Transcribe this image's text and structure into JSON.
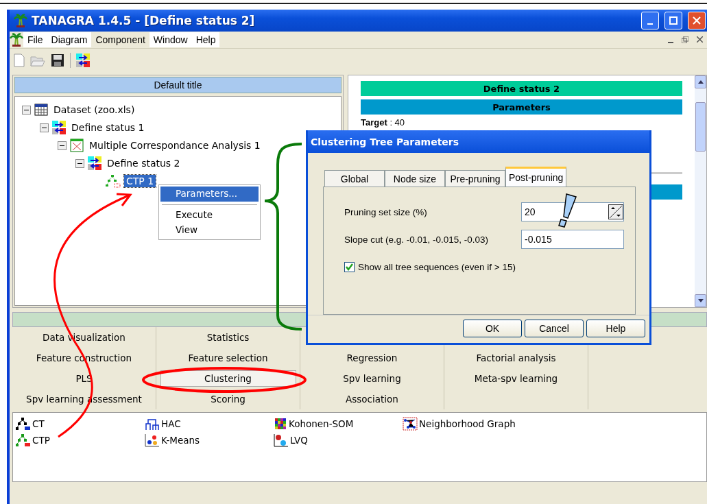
{
  "window": {
    "title": "TANAGRA 1.4.5 - [Define status 2]"
  },
  "menu": [
    {
      "label": "File",
      "selected": false
    },
    {
      "label": "Diagram",
      "selected": false
    },
    {
      "label": "Component",
      "selected": true
    },
    {
      "label": "Window",
      "selected": false
    },
    {
      "label": "Help",
      "selected": false
    }
  ],
  "diagram": {
    "title": "Default title",
    "tree": [
      {
        "label": "Dataset (zoo.xls)",
        "kind": "dataset",
        "selected": false,
        "expanded": true,
        "children": [
          {
            "label": "Define status 1",
            "kind": "status",
            "selected": false,
            "expanded": true,
            "children": [
              {
                "label": "Multiple Correspondance Analysis 1",
                "kind": "factorial",
                "selected": false,
                "expanded": true,
                "children": [
                  {
                    "label": "Define status 2",
                    "kind": "status",
                    "selected": false,
                    "expanded": true,
                    "children": [
                      {
                        "label": "CTP 1",
                        "kind": "tree",
                        "selected": true
                      }
                    ]
                  }
                ]
              }
            ]
          }
        ]
      }
    ]
  },
  "context_menu": {
    "items": [
      {
        "label": "Parameters...",
        "selected": true,
        "divider_after": true
      },
      {
        "label": "Execute",
        "selected": false,
        "divider_after": false
      },
      {
        "label": "View",
        "selected": false,
        "divider_after": false
      }
    ]
  },
  "report": {
    "title": "Define status 2",
    "section": "Parameters",
    "line": "**Target** : 40"
  },
  "dialog": {
    "title": "Clustering Tree Parameters",
    "tabs": [
      {
        "label": "Global",
        "selected": false
      },
      {
        "label": "Node size",
        "selected": false
      },
      {
        "label": "Pre-pruning",
        "selected": false
      },
      {
        "label": "Post-pruning",
        "selected": true
      }
    ],
    "fields": [
      {
        "label": "Pruning set size (%)",
        "value": "20",
        "kind": "spin"
      },
      {
        "label": "Slope cut (e.g. -0.01, -0.015, -0.03)",
        "value": "-0.015",
        "kind": "text"
      }
    ],
    "checkbox": {
      "label": "Show all tree sequences (even if > 15)",
      "checked": true
    },
    "buttons": [
      "OK",
      "Cancel",
      "Help"
    ]
  },
  "palette": {
    "rows": [
      [
        {
          "label": "Data visualization",
          "selected": false
        },
        {
          "label": "Statistics",
          "selected": false
        }
      ],
      [
        {
          "label": "Feature construction",
          "selected": false
        },
        {
          "label": "Feature selection",
          "selected": false
        },
        {
          "label": "Regression",
          "selected": false
        },
        {
          "label": "Factorial analysis",
          "selected": false
        }
      ],
      [
        {
          "label": "PLS",
          "selected": false
        },
        {
          "label": "Clustering",
          "selected": true
        },
        {
          "label": "Spv learning",
          "selected": false
        },
        {
          "label": "Meta-spv learning",
          "selected": false
        }
      ],
      [
        {
          "label": "Spv learning assessment",
          "selected": false
        },
        {
          "label": "Scoring",
          "selected": false
        },
        {
          "label": "Association",
          "selected": false
        }
      ]
    ]
  },
  "components": [
    {
      "label": "CT",
      "kind": "ct"
    },
    {
      "label": "CTP",
      "kind": "ctp"
    },
    {
      "label": "HAC",
      "kind": "hac"
    },
    {
      "label": "K-Means",
      "kind": "kmeans"
    },
    {
      "label": "Kohonen-SOM",
      "kind": "som"
    },
    {
      "label": "LVQ",
      "kind": "lvq"
    },
    {
      "label": "Neighborhood Graph",
      "kind": "graph"
    }
  ]
}
